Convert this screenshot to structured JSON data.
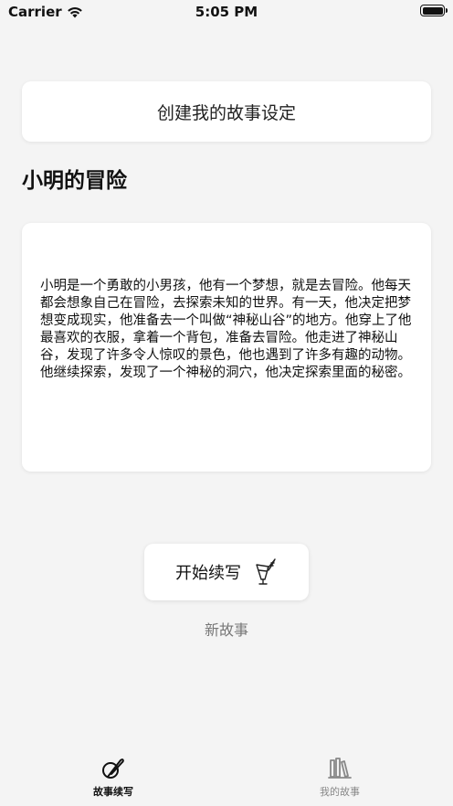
{
  "status_bar": {
    "carrier": "Carrier",
    "time": "5:05 PM"
  },
  "create_setting_button": "创建我的故事设定",
  "story": {
    "title": "小明的冒险",
    "body": "小明是一个勇敢的小男孩，他有一个梦想，就是去冒险。他每天都会想象自己在冒险，去探索未知的世界。有一天，他决定把梦想变成现实，他准备去一个叫做“神秘山谷”的地方。他穿上了他最喜欢的衣服，拿着一个背包，准备去冒险。他走进了神秘山谷，发现了许多令人惊叹的景色，他也遇到了许多有趣的动物。他继续探索，发现了一个神秘的洞穴，他决定探索里面的秘密。"
  },
  "continue_button": "开始续写",
  "new_story_link": "新故事",
  "tabs": [
    {
      "label": "故事续写",
      "icon": "quill-icon",
      "active": true
    },
    {
      "label": "我的故事",
      "icon": "books-icon",
      "active": false
    }
  ],
  "colors": {
    "background": "#f4f4f4",
    "card": "#ffffff",
    "active_tab": "#111111",
    "inactive_tab": "#888888"
  }
}
